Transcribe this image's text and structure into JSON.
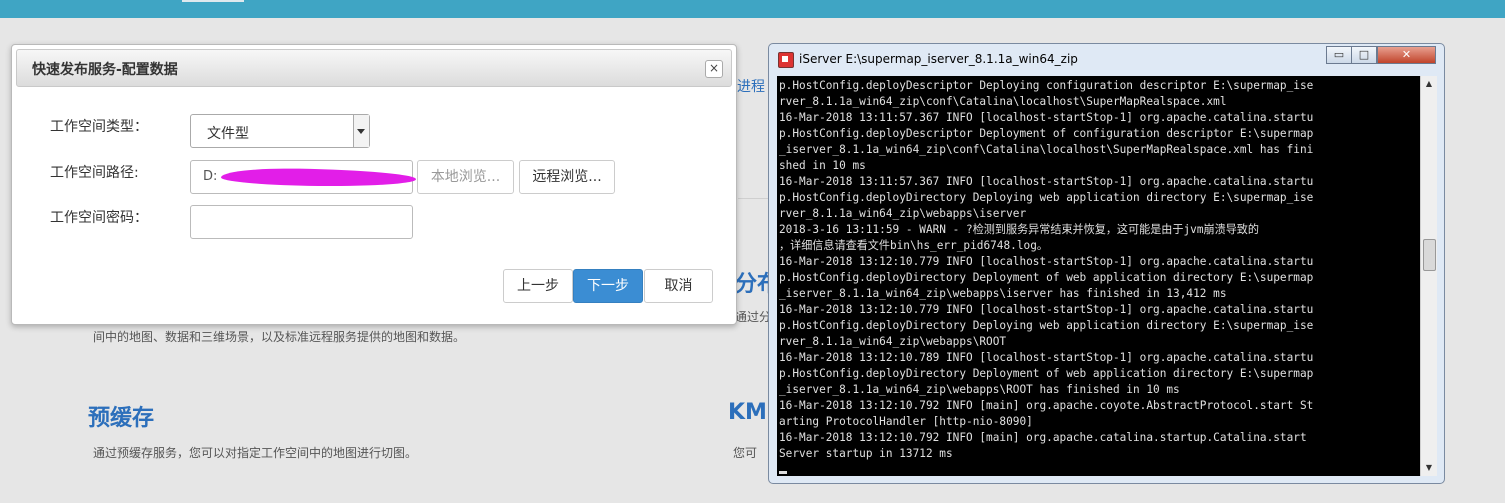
{
  "background_page": {
    "process_link": "进程",
    "fragment_fen": "分布",
    "fragment_tongguo": "通过分",
    "desc_line": "间中的地图、数据和三维场景，以及标准远程服务提供的地图和数据。",
    "precache_title": "预缓存",
    "precache_desc": "通过预缓存服务，您可以对指定工作空间中的地图进行切图。",
    "kml_title": "KM",
    "kml_desc": "您可"
  },
  "dialog": {
    "title": "快速发布服务-配置数据",
    "close_glyph": "×",
    "workspace_type_label": "工作空间类型：",
    "workspace_type_value": "文件型",
    "workspace_path_label": "工作空间路径:",
    "workspace_path_value": "D:",
    "workspace_password_label": "工作空间密码：",
    "workspace_password_value": "",
    "local_browse": "本地浏览...",
    "remote_browse": "远程浏览...",
    "prev": "上一步",
    "next": "下一步",
    "cancel": "取消",
    "colors": {
      "primary": "#3b8dd3",
      "redaction": "#e21ee8"
    }
  },
  "console": {
    "title": "iServer E:\\supermap_iserver_8.1.1a_win64_zip",
    "window_controls": {
      "minimize": "▭",
      "maximize": "□",
      "close": "✕"
    },
    "lines": [
      "p.HostConfig.deployDescriptor Deploying configuration descriptor E:\\supermap_ise",
      "rver_8.1.1a_win64_zip\\conf\\Catalina\\localhost\\SuperMapRealspace.xml",
      "16-Mar-2018 13:11:57.367 INFO [localhost-startStop-1] org.apache.catalina.startu",
      "p.HostConfig.deployDescriptor Deployment of configuration descriptor E:\\supermap",
      "_iserver_8.1.1a_win64_zip\\conf\\Catalina\\localhost\\SuperMapRealspace.xml has fini",
      "shed in 10 ms",
      "16-Mar-2018 13:11:57.367 INFO [localhost-startStop-1] org.apache.catalina.startu",
      "p.HostConfig.deployDirectory Deploying web application directory E:\\supermap_ise",
      "rver_8.1.1a_win64_zip\\webapps\\iserver",
      "2018-3-16 13:11:59 - WARN - ?检测到服务异常结束并恢复，这可能是由于jvm崩溃导致的",
      "，详细信息请查看文件bin\\hs_err_pid6748.log。",
      "16-Mar-2018 13:12:10.779 INFO [localhost-startStop-1] org.apache.catalina.startu",
      "p.HostConfig.deployDirectory Deployment of web application directory E:\\supermap",
      "_iserver_8.1.1a_win64_zip\\webapps\\iserver has finished in 13,412 ms",
      "16-Mar-2018 13:12:10.779 INFO [localhost-startStop-1] org.apache.catalina.startu",
      "p.HostConfig.deployDirectory Deploying web application directory E:\\supermap_ise",
      "rver_8.1.1a_win64_zip\\webapps\\ROOT",
      "16-Mar-2018 13:12:10.789 INFO [localhost-startStop-1] org.apache.catalina.startu",
      "p.HostConfig.deployDirectory Deployment of web application directory E:\\supermap",
      "_iserver_8.1.1a_win64_zip\\webapps\\ROOT has finished in 10 ms",
      "16-Mar-2018 13:12:10.792 INFO [main] org.apache.coyote.AbstractProtocol.start St",
      "arting ProtocolHandler [http-nio-8090]",
      "16-Mar-2018 13:12:10.792 INFO [main] org.apache.catalina.startup.Catalina.start",
      "Server startup in 13712 ms"
    ]
  }
}
